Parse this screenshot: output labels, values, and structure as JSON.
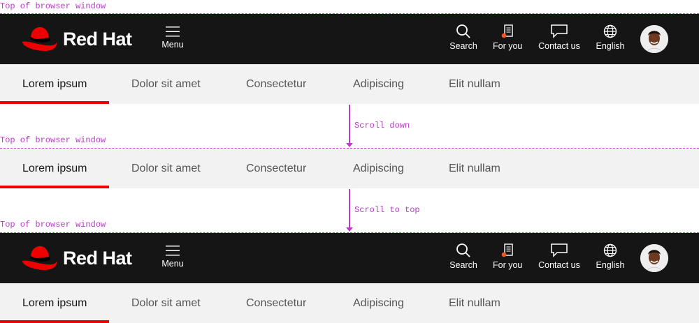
{
  "annotations": {
    "top_of_window": "Top of browser window",
    "scroll_down": "Scroll down",
    "scroll_to_top": "Scroll to top"
  },
  "masthead": {
    "brand": "Red Hat",
    "menu_label": "Menu",
    "tools": {
      "search": "Search",
      "for_you": "For you",
      "contact": "Contact us",
      "language": "English"
    }
  },
  "subnav": {
    "items": [
      "Lorem ipsum",
      "Dolor sit amet",
      "Consectetur",
      "Adipiscing",
      "Elit nullam"
    ]
  },
  "colors": {
    "masthead_bg": "#151515",
    "brand_red": "#ee0000",
    "subnav_bg": "#f2f2f2",
    "annotation": "#b93dc8",
    "notification_dot": "#f0561d"
  }
}
